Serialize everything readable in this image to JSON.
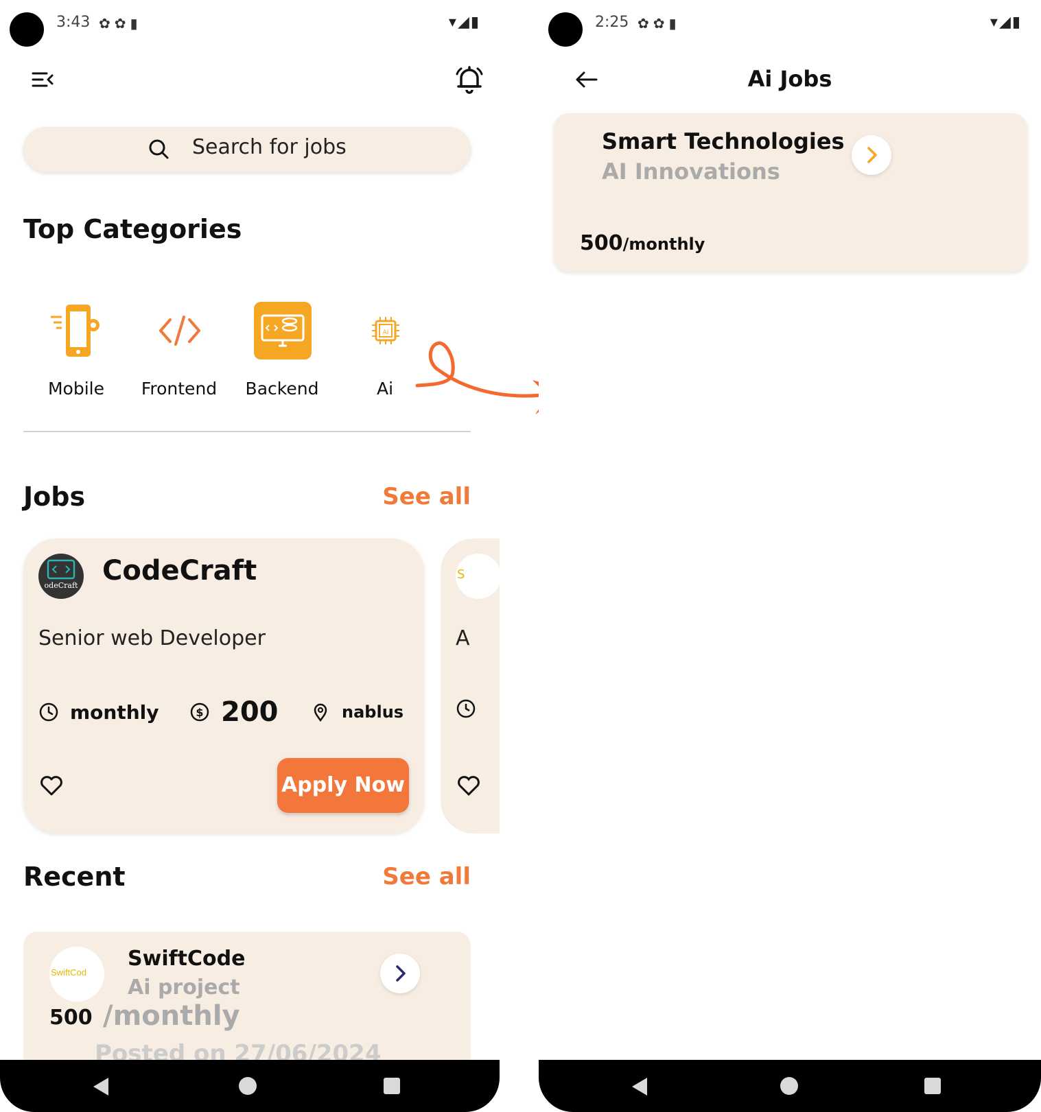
{
  "colors": {
    "accent": "#f3763a",
    "card_bg": "#f8ede3",
    "category_orange": "#f5a623",
    "nav_bar": "#000000"
  },
  "left_screen": {
    "status": {
      "time": "3:43"
    },
    "header": {
      "menu_icon": "menu-collapse-icon",
      "bell_icon": "alarm-bell-icon"
    },
    "search": {
      "placeholder": "Search for jobs",
      "icon": "search-icon"
    },
    "categories": {
      "title": "Top Categories",
      "items": [
        {
          "label": "Mobile",
          "icon": "mobile-settings-icon"
        },
        {
          "label": "Frontend",
          "icon": "code-brackets-icon"
        },
        {
          "label": "Backend",
          "icon": "server-monitor-icon"
        },
        {
          "label": "Ai",
          "icon": "ai-chip-icon"
        }
      ]
    },
    "jobs": {
      "title": "Jobs",
      "see_all": "See all",
      "card": {
        "company": "CodeCraft",
        "logo_text": "odeCraft",
        "title": "Senior web Developer",
        "period": "monthly",
        "salary": "200",
        "location": "nablus",
        "apply_label": "Apply Now"
      },
      "peek_card": {
        "logo_text": "S",
        "title_initial": "A"
      }
    },
    "recent": {
      "title": "Recent",
      "see_all": "See all",
      "card": {
        "company": "SwiftCode",
        "logo_text": "SwiftCod",
        "subtitle": "Ai project",
        "salary": "500",
        "period": "/monthly",
        "posted": "Posted on 27/06/2024"
      }
    }
  },
  "right_screen": {
    "status": {
      "time": "2:25"
    },
    "header": {
      "title": "Ai Jobs",
      "back_icon": "back-arrow-icon"
    },
    "card": {
      "company": "Smart Technologies",
      "subtitle": "AI Innovations",
      "salary": "500",
      "period": "/monthly"
    }
  }
}
